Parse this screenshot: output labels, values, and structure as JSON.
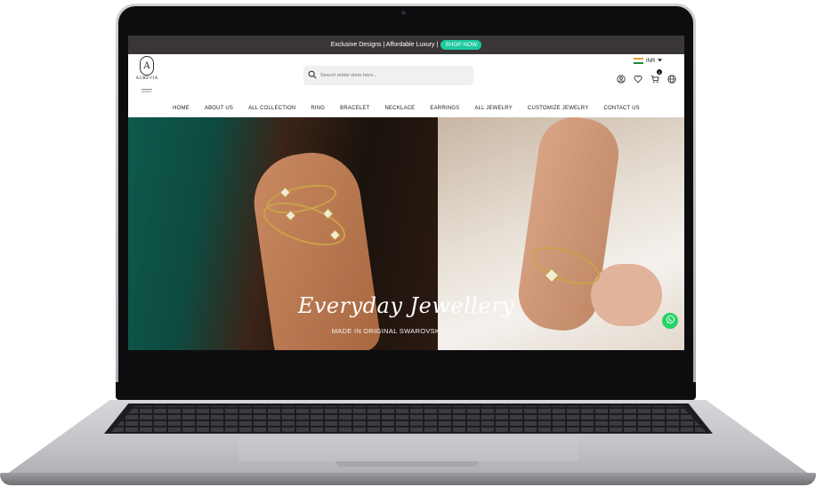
{
  "promo": {
    "text": "Exclusive Designs | Affordable Luxury |",
    "cta": "SHOP NOW"
  },
  "logo": {
    "monogram": "A",
    "name": "AUREVIA",
    "sub": "JEWEL"
  },
  "search": {
    "placeholder": "Search entire store here..."
  },
  "currency": {
    "code": "INR"
  },
  "cart": {
    "count": "0"
  },
  "nav": {
    "items": [
      "HOME",
      "ABOUT US",
      "ALL COLLECTION",
      "RING",
      "BRACELET",
      "NECKLACE",
      "EARRINGS",
      "ALL JEWELRY",
      "CUSTOMIZE JEWELRY",
      "CONTACT US"
    ]
  },
  "hero": {
    "title": "Everyday Jewellery",
    "subtitle": "MADE IN ORIGINAL SWAROVSKI CRYSTALS"
  },
  "colors": {
    "promo_bg": "#3a3638",
    "cta_bg": "#1ec9a0",
    "whatsapp": "#25d366",
    "gold": "#c9a24a"
  },
  "icons": [
    "search-icon",
    "india-flag-icon",
    "chevron-down-icon",
    "account-icon",
    "heart-icon",
    "cart-icon",
    "globe-icon",
    "whatsapp-icon"
  ]
}
